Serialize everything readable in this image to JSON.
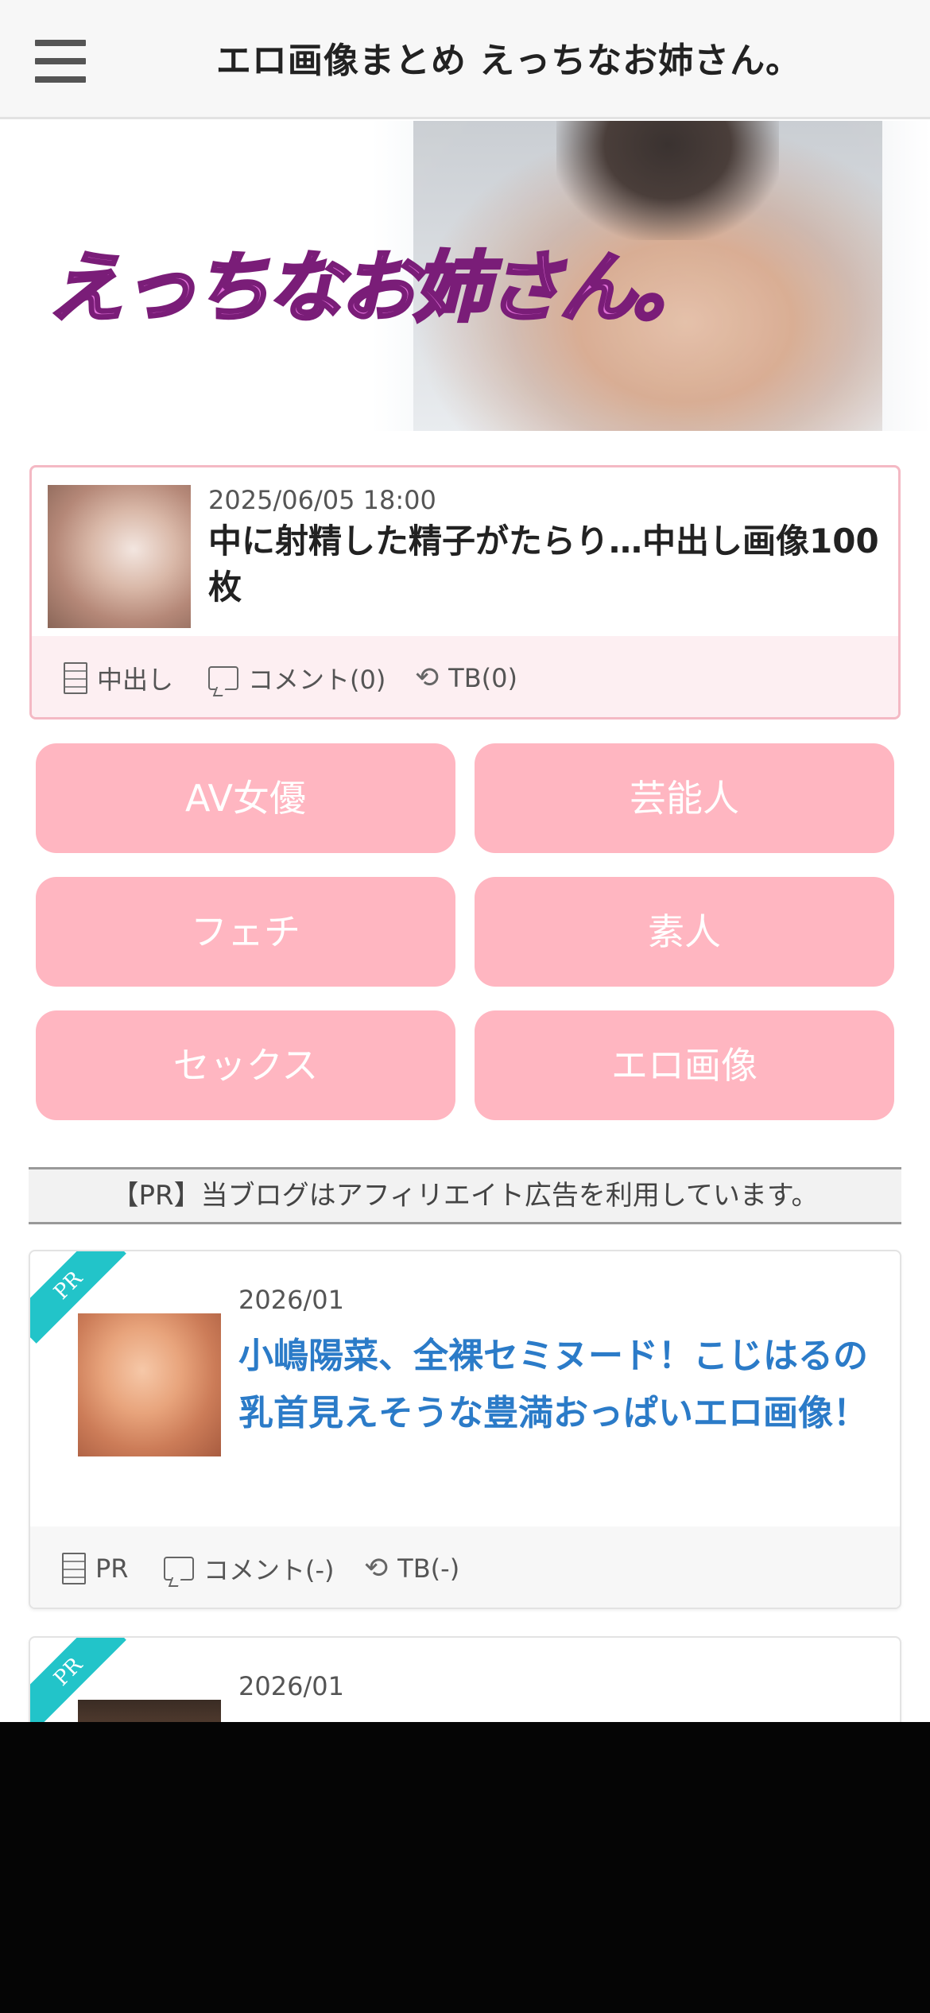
{
  "header": {
    "title": "エロ画像まとめ えっちなお姉さん。",
    "menu_icon": "hamburger-menu-icon"
  },
  "banner": {
    "logo_text": "えっちなお姉さん。"
  },
  "featured": {
    "date": "2025/06/05 18:00",
    "title": "中に射精した精子がたらり…中出し画像100枚",
    "category": "中出し",
    "comments": "コメント(0)",
    "trackbacks": "TB(0)"
  },
  "categories": [
    "AV女優",
    "芸能人",
    "フェチ",
    "素人",
    "セックス",
    "エロ画像"
  ],
  "pr_notice": "【PR】当ブログはアフィリエイト広告を利用しています。",
  "cards": [
    {
      "ribbon": "PR",
      "date": "2026/01",
      "title": "小嶋陽菜、全裸セミヌード！こじはるの乳首見えそうな豊満おっぱいエロ画像！",
      "category": "PR",
      "comments": "コメント(-)",
      "trackbacks": "TB(-)"
    },
    {
      "ribbon": "PR",
      "date": "2026/01"
    }
  ],
  "colors": {
    "accent_pink": "#ffb6c1",
    "link_blue": "#2b7bc8",
    "ribbon_teal": "#22c4c9"
  }
}
